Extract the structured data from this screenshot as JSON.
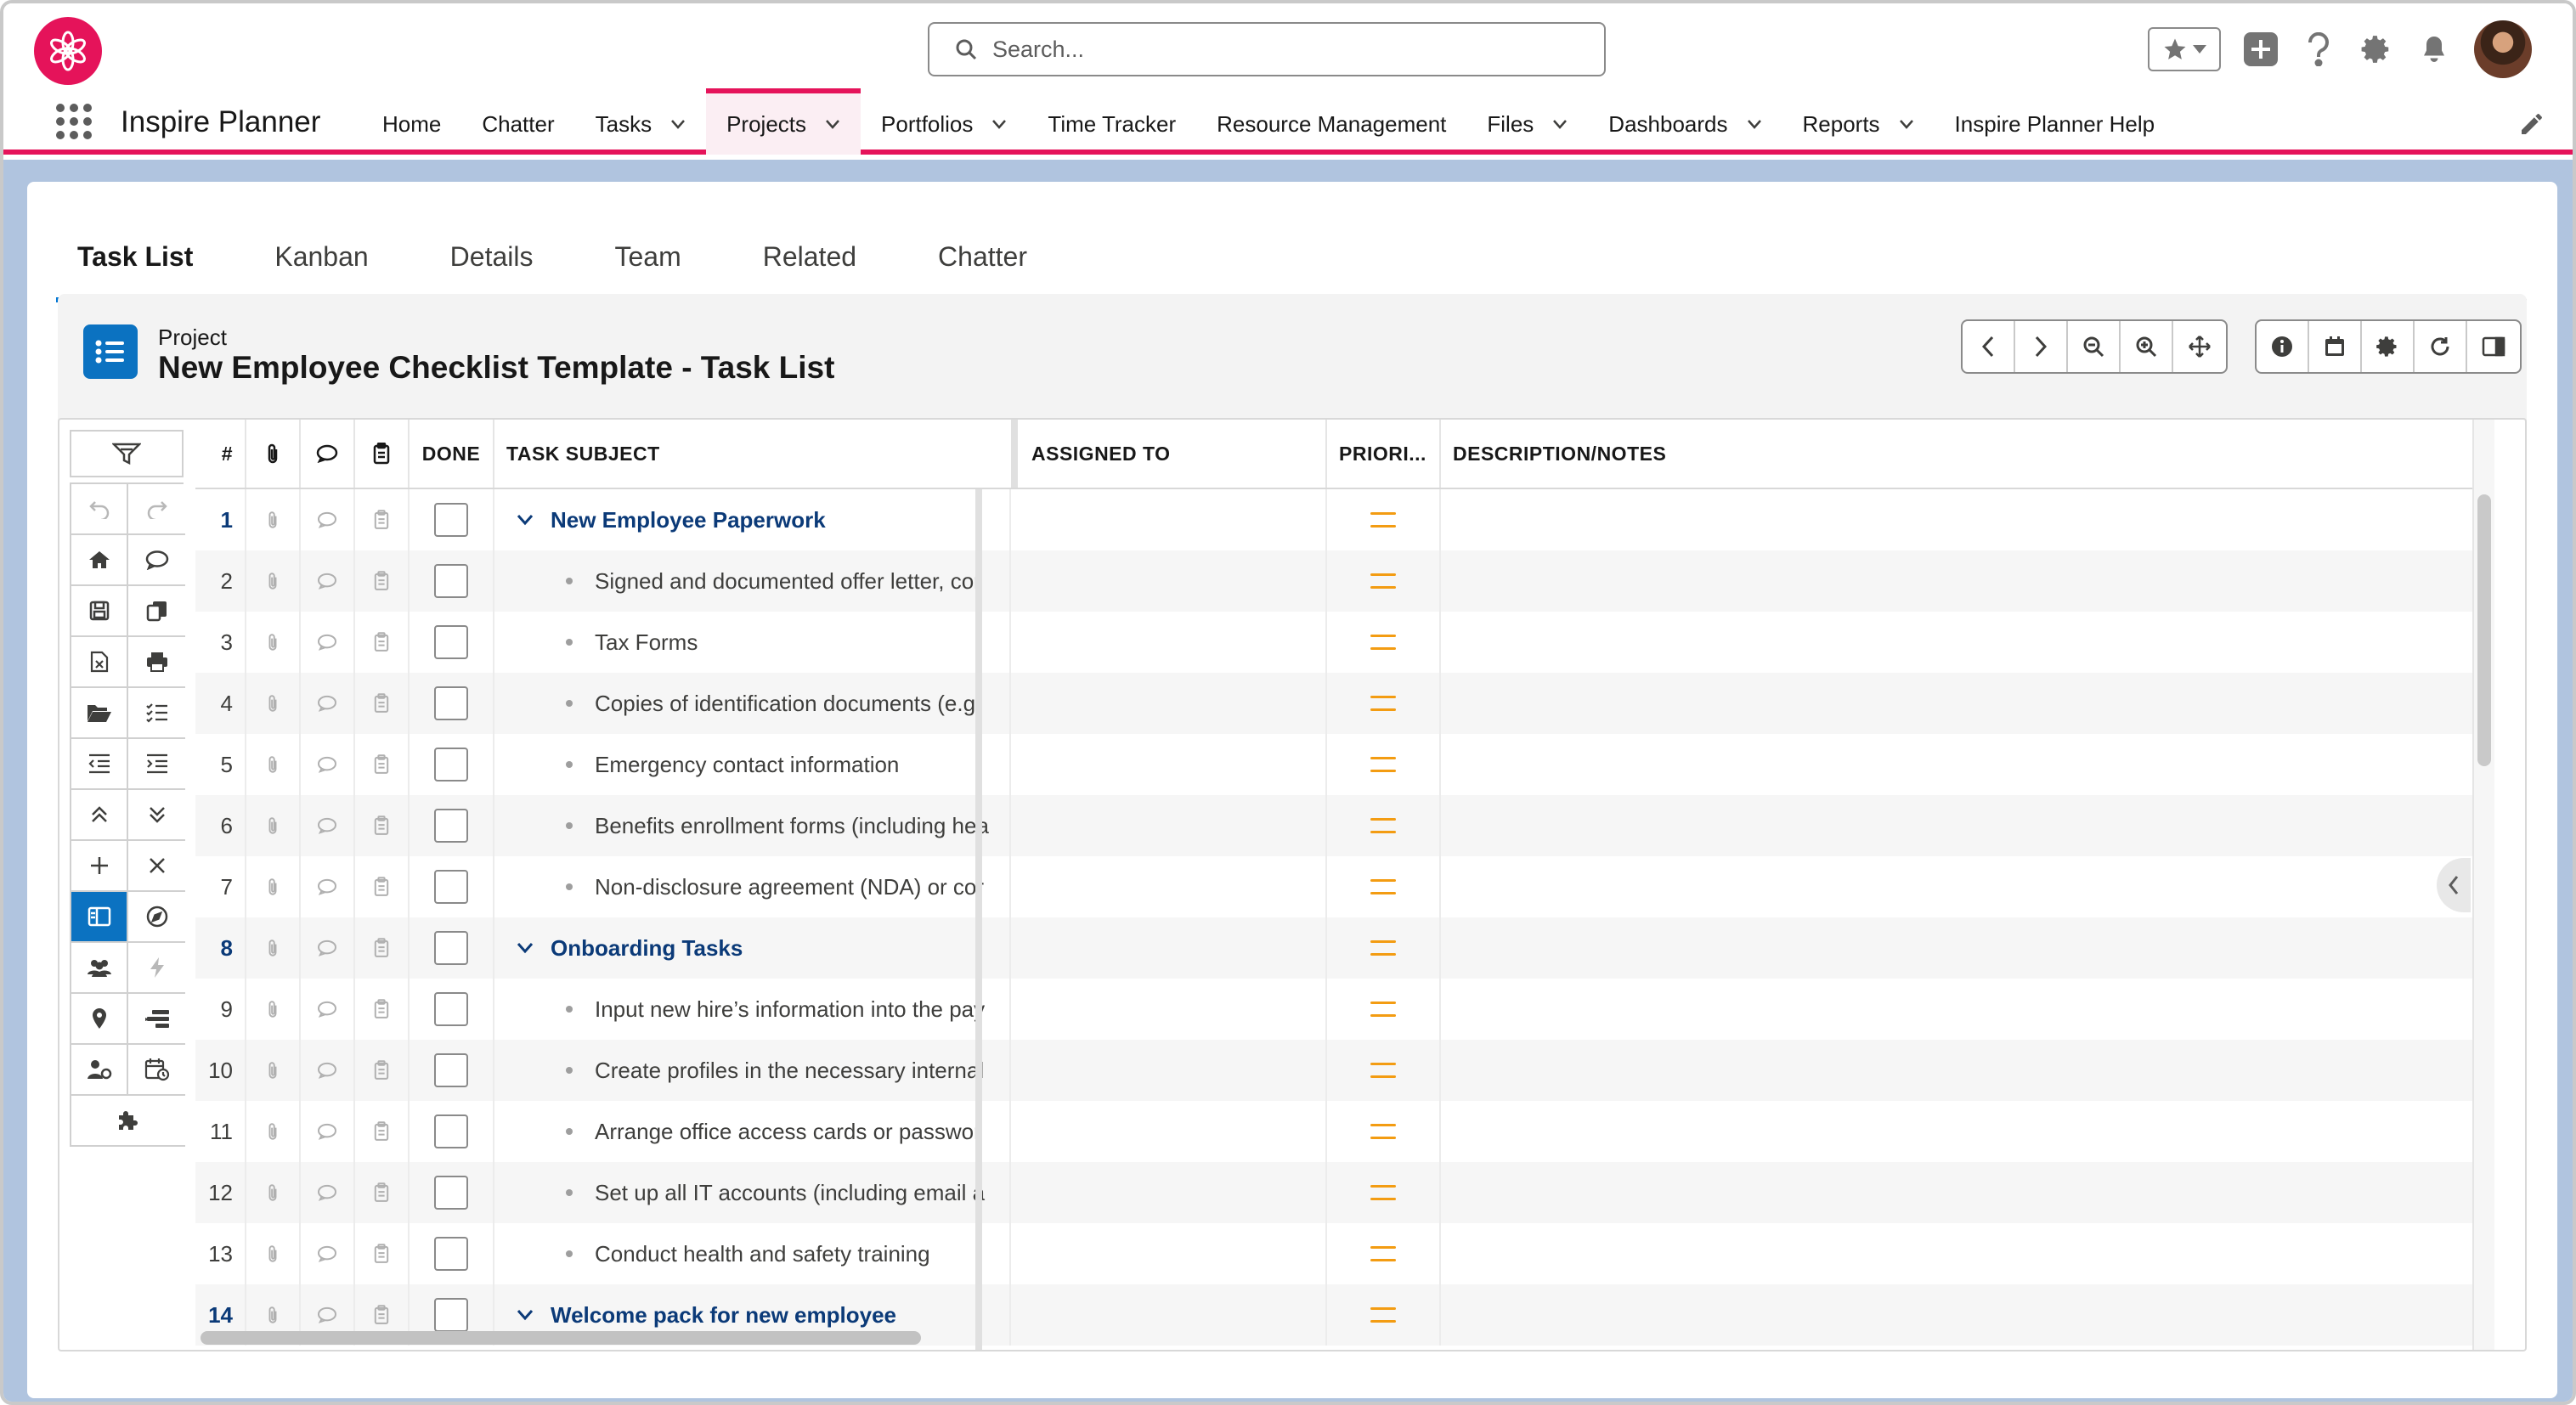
{
  "header": {
    "search_placeholder": "Search...",
    "icons": [
      "favorites-star-icon",
      "add-icon",
      "help-icon",
      "setup-gear-icon",
      "notifications-bell-icon",
      "avatar"
    ]
  },
  "app": {
    "name": "Inspire Planner",
    "nav": [
      {
        "label": "Home",
        "dropdown": false
      },
      {
        "label": "Chatter",
        "dropdown": false
      },
      {
        "label": "Tasks",
        "dropdown": true
      },
      {
        "label": "Projects",
        "dropdown": true,
        "active": true
      },
      {
        "label": "Portfolios",
        "dropdown": true
      },
      {
        "label": "Time Tracker",
        "dropdown": false
      },
      {
        "label": "Resource Management",
        "dropdown": false
      },
      {
        "label": "Files",
        "dropdown": true
      },
      {
        "label": "Dashboards",
        "dropdown": true
      },
      {
        "label": "Reports",
        "dropdown": true
      },
      {
        "label": "Inspire Planner Help",
        "dropdown": false
      }
    ]
  },
  "tabs": [
    "Task List",
    "Kanban",
    "Details",
    "Team",
    "Related",
    "Chatter"
  ],
  "active_tab": "Task List",
  "project": {
    "label": "Project",
    "title": "New Employee Checklist Template - Task List"
  },
  "table": {
    "columns": {
      "num": "#",
      "done": "DONE",
      "subject": "TASK SUBJECT",
      "assigned": "ASSIGNED TO",
      "priority": "PRIORI...",
      "description": "DESCRIPTION/NOTES"
    },
    "rows": [
      {
        "num": "1",
        "subject": "New Employee Paperwork",
        "group": true
      },
      {
        "num": "2",
        "subject": "Signed and documented offer letter, cor",
        "group": false
      },
      {
        "num": "3",
        "subject": "Tax Forms",
        "group": false
      },
      {
        "num": "4",
        "subject": "Copies of identification documents (e.g.",
        "group": false
      },
      {
        "num": "5",
        "subject": "Emergency contact information",
        "group": false
      },
      {
        "num": "6",
        "subject": "Benefits enrollment forms (including hea",
        "group": false
      },
      {
        "num": "7",
        "subject": "Non-disclosure agreement (NDA) or cor",
        "group": false
      },
      {
        "num": "8",
        "subject": "Onboarding Tasks",
        "group": true
      },
      {
        "num": "9",
        "subject": "Input new hire’s information into the pay",
        "group": false
      },
      {
        "num": "10",
        "subject": "Create profiles in the necessary internal",
        "group": false
      },
      {
        "num": "11",
        "subject": "Arrange office access cards or passwor",
        "group": false
      },
      {
        "num": "12",
        "subject": "Set up all IT accounts (including email a",
        "group": false
      },
      {
        "num": "13",
        "subject": "Conduct health and safety training",
        "group": false
      },
      {
        "num": "14",
        "subject": "Welcome pack for new employee",
        "group": true
      }
    ]
  },
  "colors": {
    "brand": "#e5135a",
    "accent": "#0176d3",
    "priority_medium": "#f39c12",
    "group_text": "#0b3a78"
  }
}
